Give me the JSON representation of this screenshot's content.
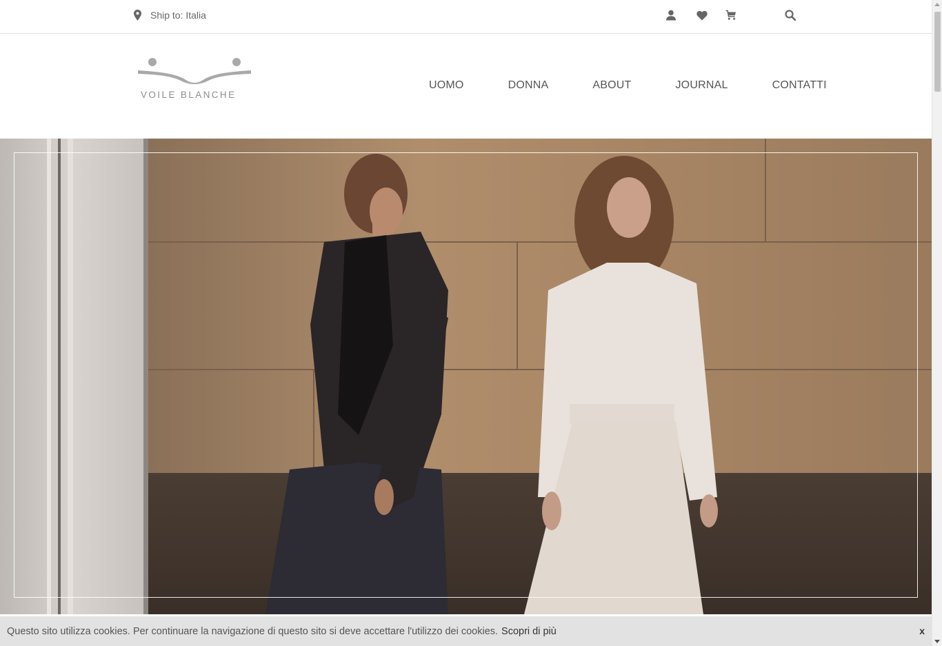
{
  "topbar": {
    "ship_label": "Ship to: Italia",
    "icons": [
      "user-icon",
      "heart-icon",
      "cart-icon",
      "search-icon"
    ]
  },
  "header": {
    "logo_text": "VOILE BLANCHE",
    "nav": [
      "UOMO",
      "DONNA",
      "ABOUT",
      "JOURNAL",
      "CONTATTI"
    ]
  },
  "hero": {
    "image_alt": "Campaign photo: man in dark suit and woman in white blouse and trousers against a wooden wall",
    "frame_color": "#ffffff"
  },
  "cookie_bar": {
    "message": "Questo sito utilizza cookies. Per continuare la navigazione di questo sito si deve accettare l'utilizzo dei cookies.",
    "link_label": "Scopri di più",
    "close_label": "x"
  },
  "colors": {
    "text": "#555555",
    "cookie_bg": "#e2e2e2",
    "logo_grey": "#a9a9a9"
  }
}
